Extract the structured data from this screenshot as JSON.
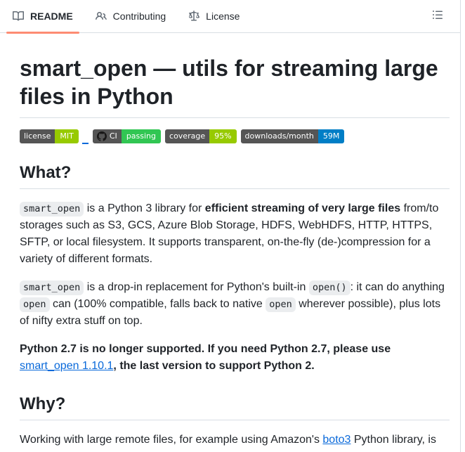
{
  "tabbar": {
    "tabs": [
      {
        "label": "README",
        "icon": "book-icon",
        "active": true
      },
      {
        "label": "Contributing",
        "icon": "people-icon",
        "active": false
      },
      {
        "label": "License",
        "icon": "law-icon",
        "active": false
      }
    ],
    "outline_icon": "list-unordered-icon",
    "active_underline_color": "#fd8c73"
  },
  "article": {
    "title": "smart_open — utils for streaming large files in Python",
    "badges": [
      {
        "label": "license",
        "value": "MIT",
        "label_color": "#555555",
        "value_color": "#97ca00",
        "logo": null,
        "trailing_underscore": true
      },
      {
        "label": "CI",
        "value": "passing",
        "label_color": "#555555",
        "value_color": "#31c653",
        "logo": "github-logo-icon",
        "trailing_underscore": false
      },
      {
        "label": "coverage",
        "value": "95%",
        "label_color": "#555555",
        "value_color": "#97ca00",
        "logo": null,
        "trailing_underscore": false
      },
      {
        "label": "downloads/month",
        "value": "59M",
        "label_color": "#555555",
        "value_color": "#007ec6",
        "logo": null,
        "trailing_underscore": false
      }
    ],
    "sections": [
      {
        "heading": "What?",
        "paragraphs": [
          [
            {
              "t": "smart_open",
              "s": "code"
            },
            {
              "t": " is a Python 3 library for ",
              "s": "plain"
            },
            {
              "t": "efficient streaming of very large files",
              "s": "bold"
            },
            {
              "t": " from/to storages such as S3, GCS, Azure Blob Storage, HDFS, WebHDFS, HTTP, HTTPS, SFTP, or local filesystem. It supports transparent, on-the-fly (de-)compression for a variety of different formats.",
              "s": "plain"
            }
          ],
          [
            {
              "t": "smart_open",
              "s": "code"
            },
            {
              "t": " is a drop-in replacement for Python's built-in ",
              "s": "plain"
            },
            {
              "t": "open()",
              "s": "code"
            },
            {
              "t": ": it can do anything ",
              "s": "plain"
            },
            {
              "t": "open",
              "s": "code"
            },
            {
              "t": " can (100% compatible, falls back to native ",
              "s": "plain"
            },
            {
              "t": "open",
              "s": "code"
            },
            {
              "t": " wherever possible), plus lots of nifty extra stuff on top.",
              "s": "plain"
            }
          ],
          [
            {
              "t": "Python 2.7 is no longer supported. If you need Python 2.7, please use ",
              "s": "bold"
            },
            {
              "t": "smart_open 1.10.1",
              "s": "link"
            },
            {
              "t": ", the last version to support Python 2.",
              "s": "bold"
            }
          ]
        ]
      },
      {
        "heading": "Why?",
        "paragraphs": [
          [
            {
              "t": "Working with large remote files, for example using Amazon's ",
              "s": "plain"
            },
            {
              "t": "boto3",
              "s": "link"
            },
            {
              "t": " Python library, is",
              "s": "plain"
            }
          ]
        ]
      }
    ]
  },
  "colors": {
    "text": "#1f2328",
    "link": "#0969da",
    "border": "#d8dee4",
    "tab_accent": "#fd8c73",
    "icon_gray": "#636c76",
    "badge_label_bg": "#555555"
  }
}
